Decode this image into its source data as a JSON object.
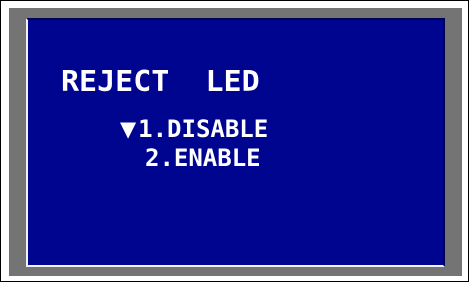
{
  "screen": {
    "title": "REJECT  LED",
    "cursor_icon": "down-triangle",
    "options": [
      {
        "label": "1.DISABLE",
        "selected": true
      },
      {
        "label": "2.ENABLE",
        "selected": false
      }
    ]
  },
  "colors": {
    "screen_bg": "#00058f",
    "text": "#ffffff",
    "bezel": "#747474"
  }
}
